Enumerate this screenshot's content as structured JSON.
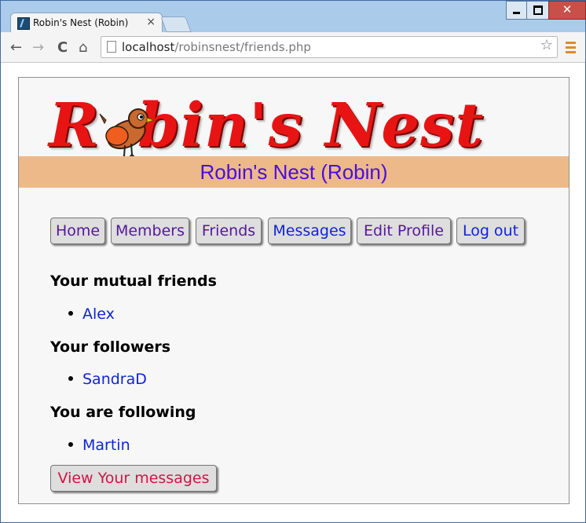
{
  "browser": {
    "tab_title": "Robin's Nest (Robin)",
    "tab_close": "×",
    "url_host": "localhost",
    "url_path": "/robinsnest/friends.php",
    "nav": {
      "back": "←",
      "forward": "→",
      "reload": "C",
      "home": "⌂",
      "star": "☆"
    }
  },
  "page": {
    "logo_text_before": "R",
    "logo_text_after": "bin's Nest",
    "banner": "Robin's Nest (Robin)",
    "menu": [
      "Home",
      "Members",
      "Friends",
      "Messages",
      "Edit Profile",
      "Log out"
    ],
    "sections": [
      {
        "title": "Your mutual friends",
        "items": [
          "Alex"
        ]
      },
      {
        "title": "Your followers",
        "items": [
          "SandraD"
        ]
      },
      {
        "title": "You are following",
        "items": [
          "Martin"
        ]
      }
    ],
    "view_messages": "View Your messages"
  },
  "colors": {
    "logo_red": "#e81414",
    "banner_bg": "#eeb988",
    "banner_text": "#4a0ee0",
    "visited_link": "#55189a",
    "link": "#0f24d4",
    "messages_button_text": "#d21446"
  }
}
